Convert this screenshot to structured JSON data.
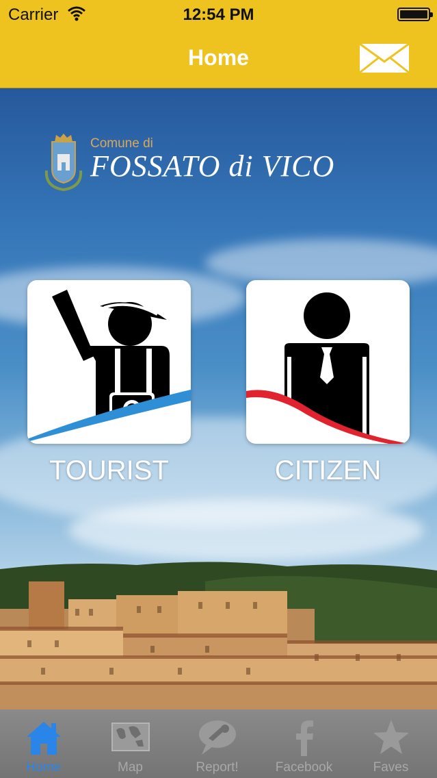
{
  "status_bar": {
    "carrier": "Carrier",
    "time": "12:54 PM"
  },
  "nav": {
    "title": "Home",
    "mail_icon": "envelope-icon"
  },
  "logo": {
    "comune": "Comune di",
    "town": "FOSSATO di VICO",
    "crest_icon": "town-crest-icon"
  },
  "tiles": [
    {
      "label": "TOURIST",
      "icon": "tourist-icon",
      "accent": "#2e8ed6"
    },
    {
      "label": "CITIZEN",
      "icon": "citizen-icon",
      "accent": "#e0232e"
    }
  ],
  "tabs": [
    {
      "label": "Home",
      "icon": "home-icon",
      "active": true
    },
    {
      "label": "Map",
      "icon": "map-icon",
      "active": false
    },
    {
      "label": "Report!",
      "icon": "report-icon",
      "active": false
    },
    {
      "label": "Facebook",
      "icon": "facebook-icon",
      "active": false
    },
    {
      "label": "Faves",
      "icon": "star-icon",
      "active": false
    }
  ],
  "colors": {
    "bar": "#eec31f",
    "tab_active": "#2a85e8",
    "tab_inactive": "#a8a8a8"
  }
}
